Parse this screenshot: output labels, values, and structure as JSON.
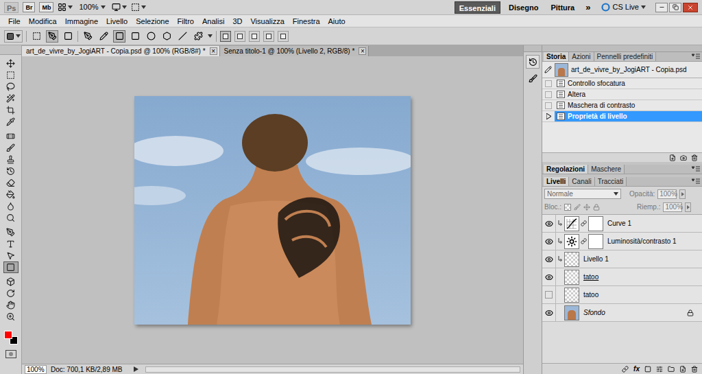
{
  "app_bar": {
    "logo": "Ps",
    "buttons": [
      "Br",
      "Mb"
    ],
    "zoom": "100%",
    "workspaces": [
      {
        "label": "Essenziali",
        "selected": true
      },
      {
        "label": "Disegno",
        "selected": false
      },
      {
        "label": "Pittura",
        "selected": false
      }
    ],
    "more": "»",
    "cs_live": "CS Live"
  },
  "menu": [
    "File",
    "Modifica",
    "Immagine",
    "Livello",
    "Selezione",
    "Filtro",
    "Analisi",
    "3D",
    "Visualizza",
    "Finestra",
    "Aiuto"
  ],
  "document_tabs": [
    {
      "label": "art_de_vivre_by_JogiART - Copia.psd @ 100% (RGB/8#) *",
      "selected": true,
      "close": "×"
    },
    {
      "label": "Senza titolo-1 @ 100% (Livello 2, RGB/8) *",
      "selected": false,
      "close": "×"
    }
  ],
  "tools": [
    {
      "selected": false
    },
    {
      "selected": false
    },
    {
      "selected": false
    },
    {
      "selected": false
    },
    {
      "selected": false
    },
    {
      "selected": false
    },
    {
      "selected": false
    },
    {
      "selected": false
    },
    {
      "selected": false
    },
    {
      "selected": false
    },
    {
      "selected": false
    },
    {
      "selected": false
    },
    {
      "selected": false
    },
    {
      "selected": false
    },
    {
      "selected": false
    },
    {
      "selected": false
    },
    {
      "selected": false
    },
    {
      "selected": true
    },
    {
      "selected": false
    },
    {
      "selected": false
    },
    {
      "selected": false
    },
    {
      "selected": false
    }
  ],
  "swatches": {
    "foreground": "#ff0000",
    "background": "#000000"
  },
  "history_panel": {
    "tabs": [
      {
        "label": "Storia",
        "selected": true
      },
      {
        "label": "Azioni",
        "selected": false
      },
      {
        "label": "Pennelli predefiniti",
        "selected": false
      }
    ],
    "snapshot": "art_de_vivre_by_JogiART - Copia.psd",
    "steps": [
      {
        "label": "Controllo sfocatura",
        "selected": false
      },
      {
        "label": "Altera",
        "selected": false
      },
      {
        "label": "Maschera di contrasto",
        "selected": false
      },
      {
        "label": "Proprietà di livello",
        "selected": true
      }
    ]
  },
  "adjustments_tabs": [
    {
      "label": "Regolazioni",
      "selected": true
    },
    {
      "label": "Maschere",
      "selected": false
    }
  ],
  "layers_panel": {
    "tabs": [
      {
        "label": "Livelli",
        "selected": true
      },
      {
        "label": "Canali",
        "selected": false
      },
      {
        "label": "Tracciati",
        "selected": false
      }
    ],
    "blend_mode": "Normale",
    "opacity_label": "Opacità:",
    "opacity": "100%",
    "lock_label": "Bloc.:",
    "fill_label": "Riemp.:",
    "fill": "100%",
    "fx": "fx",
    "layers": [
      {
        "name": "Curve 1",
        "kind": "curves",
        "visible": true,
        "clipped": true,
        "clip_base": false,
        "locked": false,
        "mask": true
      },
      {
        "name": "Luminosità/contrasto 1",
        "kind": "brightness",
        "visible": true,
        "clipped": true,
        "clip_base": false,
        "locked": false,
        "mask": true
      },
      {
        "name": "Livello 1",
        "kind": "pixel",
        "visible": true,
        "clipped": true,
        "clip_base": false,
        "locked": false,
        "mask": false
      },
      {
        "name": "tatoo",
        "kind": "pixel",
        "visible": true,
        "clipped": false,
        "clip_base": true,
        "locked": false,
        "mask": false
      },
      {
        "name": "tatoo",
        "kind": "pixel",
        "visible": false,
        "clipped": false,
        "clip_base": false,
        "locked": false,
        "mask": false
      },
      {
        "name": "Sfondo",
        "kind": "background",
        "visible": true,
        "clipped": false,
        "clip_base": false,
        "locked": true,
        "mask": false
      }
    ]
  },
  "status_bar": {
    "zoom": "100%",
    "doc": "Doc: 700,1 KB/2,89 MB"
  }
}
